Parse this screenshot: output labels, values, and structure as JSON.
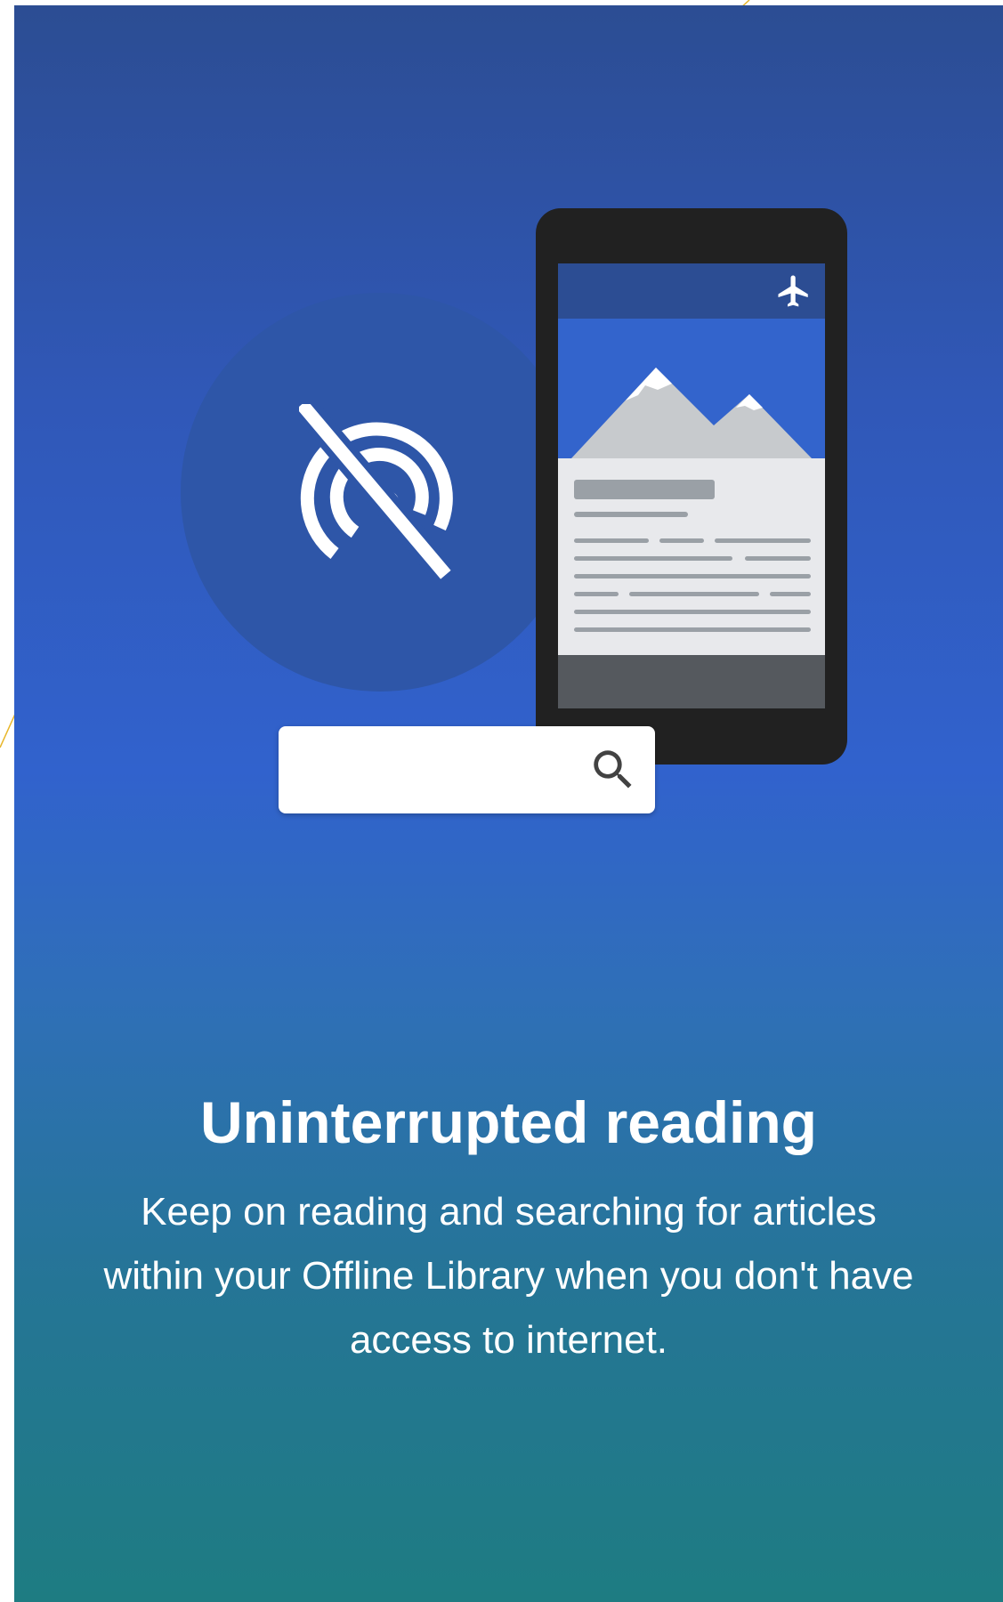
{
  "onboarding": {
    "headline": "Uninterrupted reading",
    "description": "Keep on reading and searching for articles within your Offline Library when you don't have access to internet."
  },
  "illustration": {
    "icons": [
      "wifi-off-icon",
      "airplane-icon",
      "mountain-image-icon",
      "search-icon"
    ]
  },
  "colors": {
    "gradient_top": "#2c4d93",
    "gradient_middle": "#3162cd",
    "gradient_bottom": "#1e7c82",
    "text": "#ffffff",
    "phone_body": "#212121",
    "phone_appbar": "#2c4d93",
    "decor_line": "#e8b62a"
  }
}
